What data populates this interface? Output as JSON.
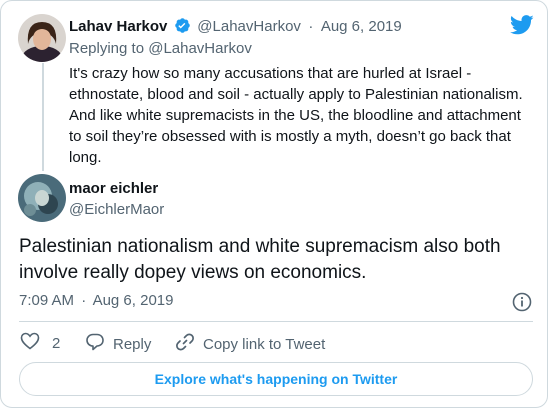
{
  "reply_tweet": {
    "author_name": "Lahav Harkov",
    "handle": "@LahavHarkov",
    "separator": "·",
    "date": "Aug 6, 2019",
    "replying_to": "Replying to @LahavHarkov",
    "text": "It's crazy how so many accusations that are hurled at Israel - ethnostate, blood and soil - actually apply to Palestinian nationalism. And like white supremacists in the US, the bloodline and attachment to soil they’re obsessed with is mostly a myth, doesn’t go back that long."
  },
  "main_tweet": {
    "author_name": "maor eichler",
    "handle": "@EichlerMaor",
    "text": "Palestinian nationalism and white supremacism also both involve really dopey views on economics.",
    "time": "7:09 AM",
    "separator": "·",
    "date": "Aug 6, 2019"
  },
  "actions": {
    "like_count": "2",
    "reply_label": "Reply",
    "copy_link_label": "Copy link to Tweet"
  },
  "explore_label": "Explore what's happening on Twitter",
  "icons": {
    "brand": "twitter-bird-icon",
    "verified": "verified-badge-icon",
    "info": "info-icon",
    "like": "heart-icon",
    "reply": "comment-icon",
    "copy": "link-icon"
  },
  "colors": {
    "accent": "#1d9bf0",
    "muted_text": "#536471",
    "border": "#cfd9de"
  }
}
